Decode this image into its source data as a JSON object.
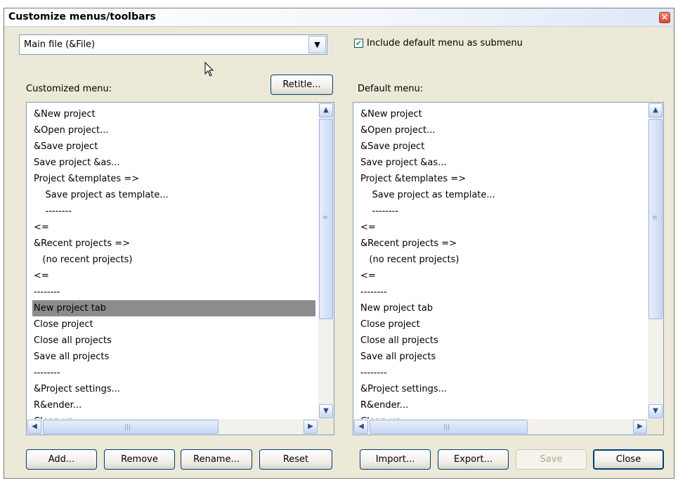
{
  "dialog": {
    "title": "Customize menus/toolbars",
    "close_glyph": "×"
  },
  "menu_select": {
    "value": "Main file (&File)",
    "arrow_glyph": "▼"
  },
  "include_default": {
    "label": "Include default menu as submenu",
    "checked": true,
    "check_glyph": "✔"
  },
  "customized": {
    "label": "Customized menu:",
    "retitle_label": "Retitle...",
    "items": [
      "&New project",
      "&Open project...",
      "&Save project",
      "Save project &as...",
      "Project &templates =>",
      "    Save project as template...",
      "    --------",
      "<=",
      "&Recent projects =>",
      "   (no recent projects)",
      "<=",
      "--------",
      "New project tab",
      "Close project",
      "Close all projects",
      "Save all projects",
      "--------",
      "&Project settings...",
      "R&ender...",
      "Clean up..."
    ],
    "selected_index": 12
  },
  "default_menu": {
    "label": "Default menu:",
    "items": [
      "&New project",
      "&Open project...",
      "&Save project",
      "Save project &as...",
      "Project &templates =>",
      "    Save project as template...",
      "    --------",
      "<=",
      "&Recent projects =>",
      "   (no recent projects)",
      "<=",
      "--------",
      "New project tab",
      "Close project",
      "Close all projects",
      "Save all projects",
      "--------",
      "&Project settings...",
      "R&ender...",
      "Clean up..."
    ]
  },
  "scrollbar": {
    "up_glyph": "▲",
    "down_glyph": "▼",
    "left_glyph": "◀",
    "right_glyph": "▶",
    "grip_v": "≡",
    "grip_h": "|||"
  },
  "buttons": {
    "add": "Add...",
    "remove": "Remove",
    "rename": "Rename...",
    "reset": "Reset",
    "import": "Import...",
    "export": "Export...",
    "save": "Save",
    "close": "Close"
  },
  "colors": {
    "selection": "#8c8c8c",
    "window_bg": "#ece9d8",
    "check": "#21a121"
  }
}
